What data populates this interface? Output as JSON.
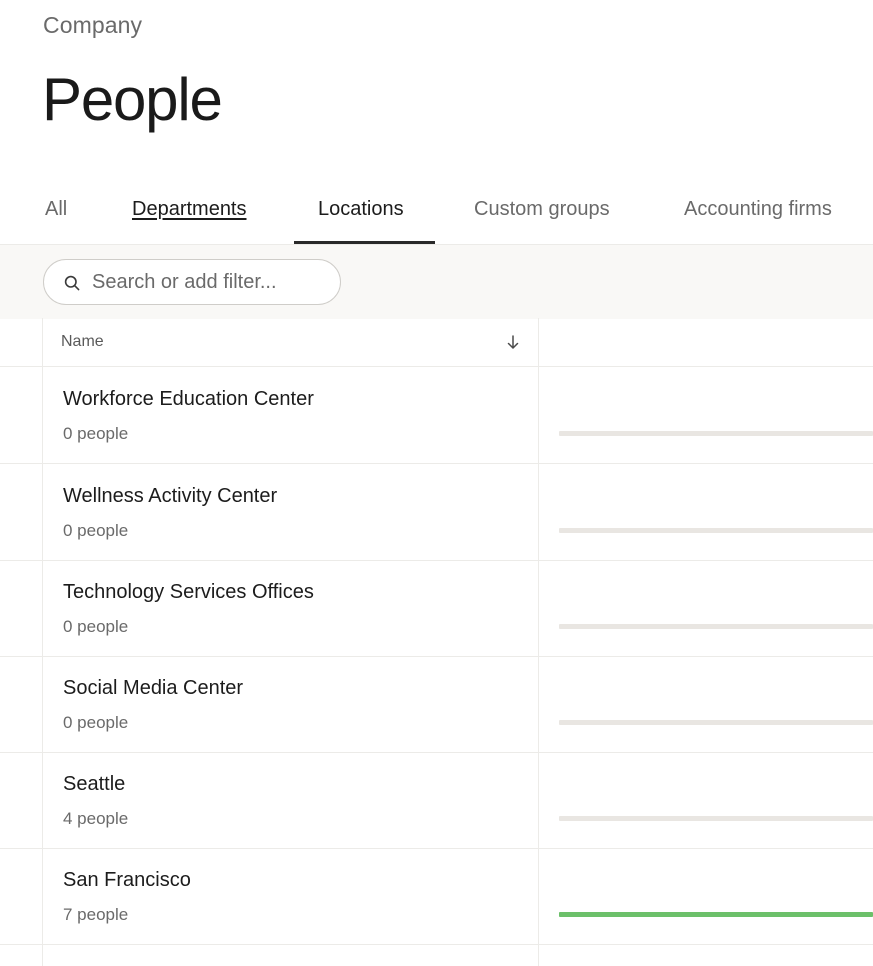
{
  "header": {
    "breadcrumb": "Company",
    "title": "People"
  },
  "tabs": [
    {
      "label": "All",
      "state": "default"
    },
    {
      "label": "Departments",
      "state": "underlined"
    },
    {
      "label": "Locations",
      "state": "active"
    },
    {
      "label": "Custom groups",
      "state": "default"
    },
    {
      "label": "Accounting firms",
      "state": "default"
    }
  ],
  "search": {
    "placeholder": "Search or add filter...",
    "value": "",
    "icon": "search-icon"
  },
  "table": {
    "columns": [
      {
        "label": "Name",
        "sort": "descending",
        "sort_icon": "arrow-down-icon"
      }
    ],
    "rows": [
      {
        "name": "Workforce Education Center",
        "count": "0 people",
        "fill_fraction": 0
      },
      {
        "name": "Wellness Activity Center",
        "count": "0 people",
        "fill_fraction": 0
      },
      {
        "name": "Technology Services Offices",
        "count": "0 people",
        "fill_fraction": 0
      },
      {
        "name": "Social Media Center",
        "count": "0 people",
        "fill_fraction": 0
      },
      {
        "name": "Seattle",
        "count": "4 people",
        "fill_fraction": 0
      },
      {
        "name": "San Francisco",
        "count": "7 people",
        "fill_fraction": 1
      }
    ]
  },
  "colors": {
    "bar_track": "#e9e6e2",
    "bar_fill": "#6cc06a",
    "filter_bar_bg": "#f9f8f6"
  }
}
